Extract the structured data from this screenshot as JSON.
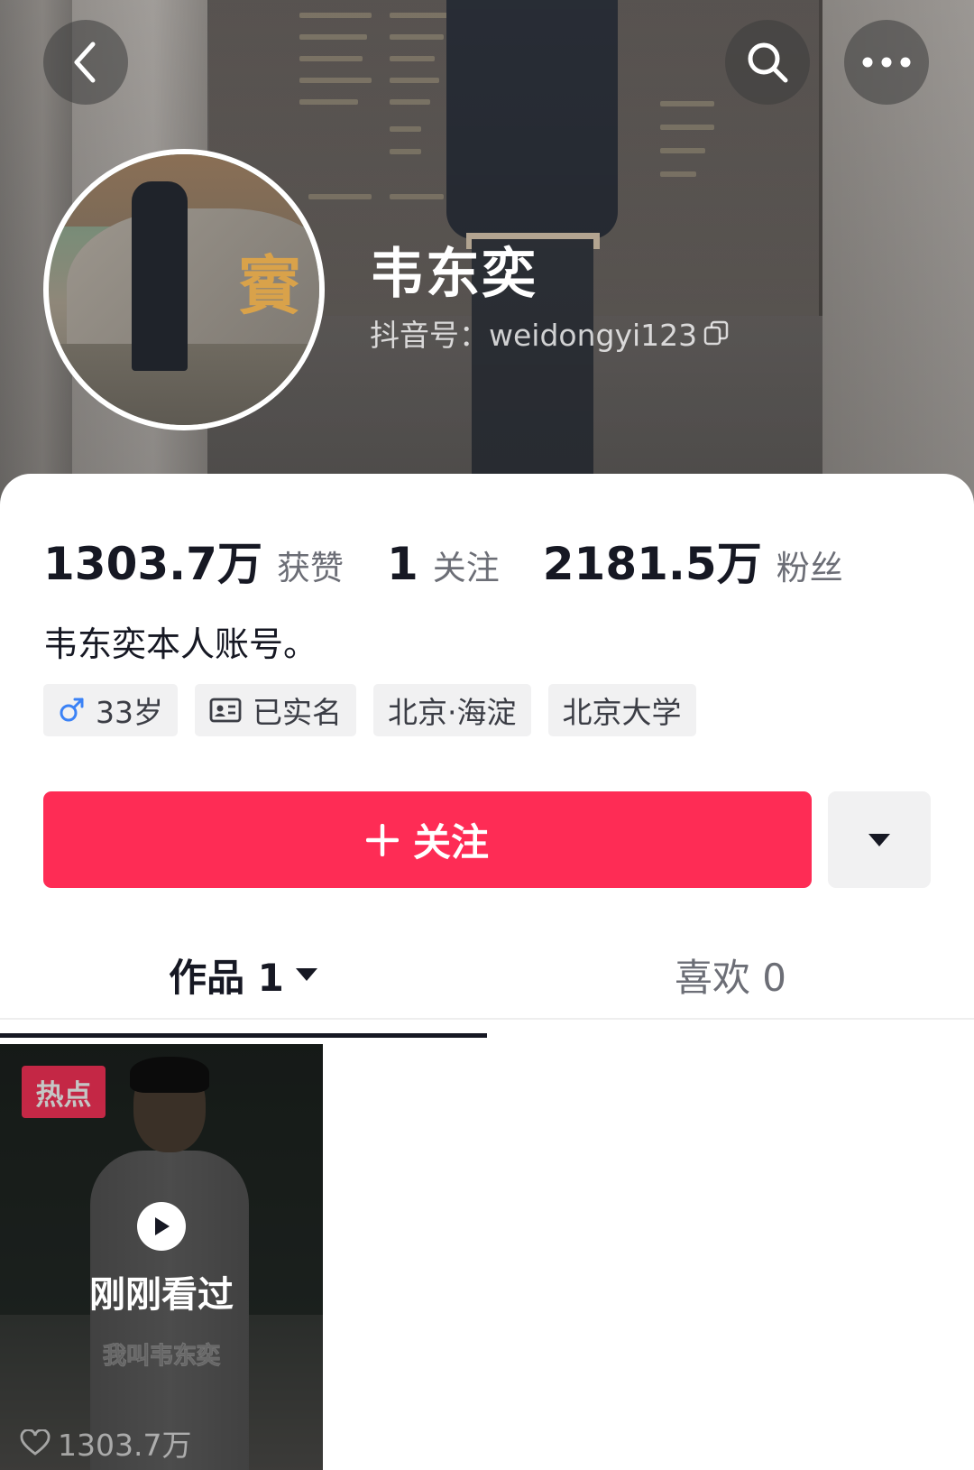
{
  "header": {
    "icons": {
      "back": "chevron-left-icon",
      "search": "search-icon",
      "more": "more-dots-icon"
    }
  },
  "profile": {
    "name": "韦东奕",
    "douyin_id": "抖音号：weidongyi123",
    "avatar_text": "賨"
  },
  "stats": [
    {
      "value": "1303.7万",
      "label": "获赞"
    },
    {
      "value": "1",
      "label": "关注"
    },
    {
      "value": "2181.5万",
      "label": "粉丝"
    }
  ],
  "bio": "韦东奕本人账号。",
  "tags": {
    "age": "33岁",
    "verified": "已实名",
    "location": "北京·海淀",
    "school": "北京大学"
  },
  "actions": {
    "follow_label": "关注",
    "accent_color": "#fe2c55"
  },
  "tabs": {
    "works": "作品 1",
    "likes": "喜欢 0"
  },
  "videos": [
    {
      "badge": "热点",
      "status": "刚刚看过",
      "caption": "我叫韦东奕",
      "likes": "1303.7万"
    }
  ]
}
